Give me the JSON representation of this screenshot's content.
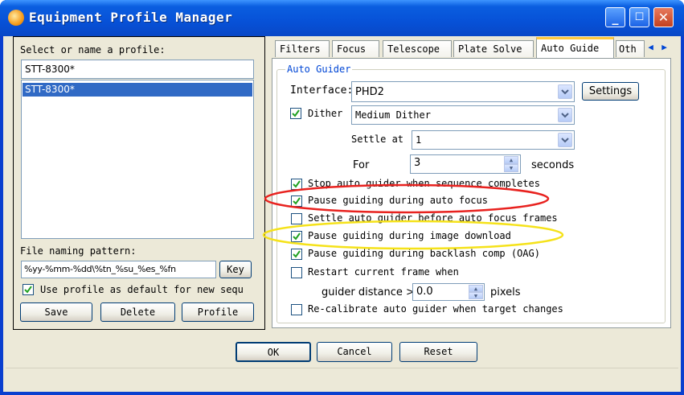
{
  "window": {
    "title": "Equipment Profile Manager"
  },
  "profile": {
    "select_label": "Select or name a profile:",
    "name_value": "STT-8300*",
    "list": [
      "STT-8300*"
    ],
    "file_naming_label": "File naming pattern:",
    "file_naming_value": "%yy-%mm-%dd\\%tn_%su_%es_%fn",
    "key_button": "Key",
    "use_default_label": "Use profile as default for new sequ",
    "save_button": "Save",
    "delete_button": "Delete",
    "profile_button": "Profile"
  },
  "tabs": [
    "Filters",
    "Focus",
    "Telescope",
    "Plate Solve",
    "Auto Guide",
    "Oth"
  ],
  "active_tab": "Auto Guide",
  "auto_guider": {
    "group_title": "Auto Guider",
    "interface_label": "Interface:",
    "interface_value": "PHD2",
    "settings_button": "Settings",
    "dither_label": "Dither",
    "dither_value": "Medium Dither",
    "settle_at_label": "Settle at",
    "settle_at_value": "1",
    "for_label": "For",
    "for_value": "3",
    "seconds_label": "seconds",
    "options": [
      {
        "label": "Stop auto guider when sequence completes",
        "checked": true
      },
      {
        "label": "Pause guiding during auto focus",
        "checked": true
      },
      {
        "label": "Settle auto guider before auto focus frames",
        "checked": false
      },
      {
        "label": "Pause guiding during image download",
        "checked": true
      },
      {
        "label": "Pause guiding during backlash comp (OAG)",
        "checked": true
      },
      {
        "label": "Restart current frame when",
        "checked": false
      }
    ],
    "guider_distance_label": "guider distance >",
    "guider_distance_value": "0.0",
    "pixels_label": "pixels",
    "recalibrate_label": "Re-calibrate auto guider when target changes",
    "recalibrate_checked": false
  },
  "footer": {
    "ok_button": "OK",
    "cancel_button": "Cancel",
    "reset_button": "Reset"
  },
  "colors": {
    "titlebar": "#0751d7",
    "client": "#ece9d8",
    "highlight_red": "#e8221f",
    "highlight_yellow": "#f5e21a",
    "selection": "#316ac5",
    "group_title": "#0046d5"
  }
}
